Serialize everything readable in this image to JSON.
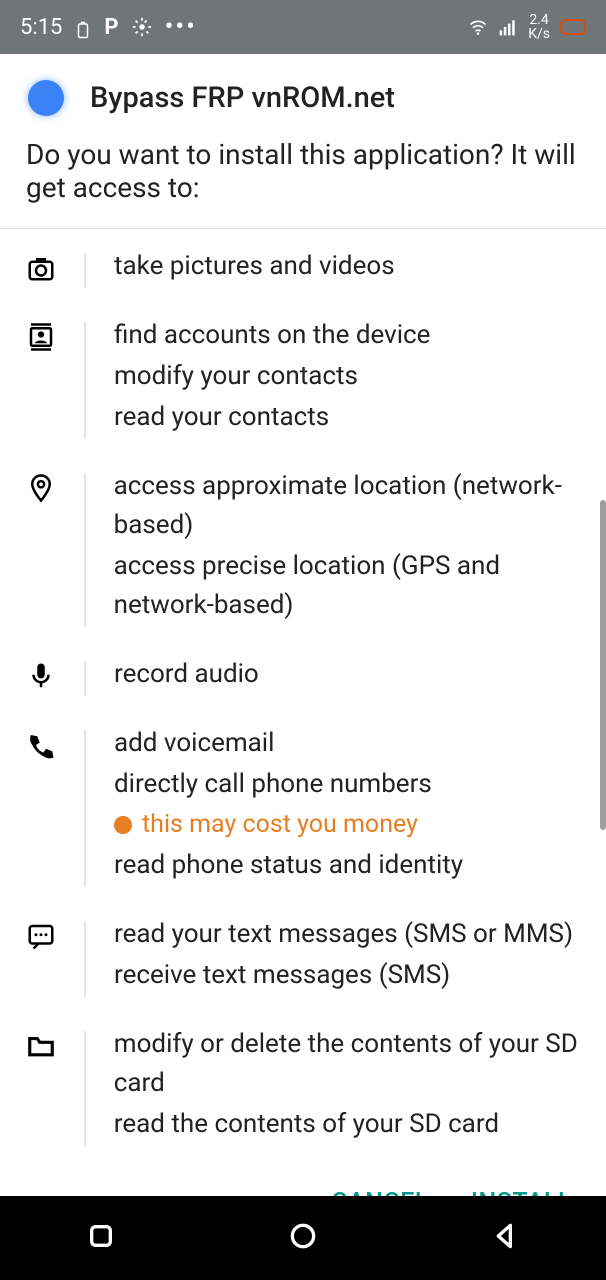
{
  "status": {
    "time": "5:15",
    "net": "2.4\nK/s"
  },
  "header": {
    "title": "Bypass FRP vnROM.net"
  },
  "prompt": "Do you want to install this application? It will get access to:",
  "perms": {
    "camera": [
      "take pictures and videos"
    ],
    "contacts": [
      "find accounts on the device",
      "modify your contacts",
      "read your contacts"
    ],
    "location": [
      "access approximate location (network-based)",
      "access precise location (GPS and network-based)"
    ],
    "mic": [
      "record audio"
    ],
    "phone": {
      "items": [
        "add voicemail",
        "directly call phone numbers"
      ],
      "warn": "this may cost you money",
      "after": [
        "read phone status and identity"
      ]
    },
    "sms": [
      "read your text messages (SMS or MMS)",
      "receive text messages (SMS)"
    ],
    "storage": [
      "modify or delete the contents of your SD card",
      "read the contents of your SD card"
    ]
  },
  "actions": {
    "cancel": "CANCEL",
    "install": "INSTALL"
  }
}
